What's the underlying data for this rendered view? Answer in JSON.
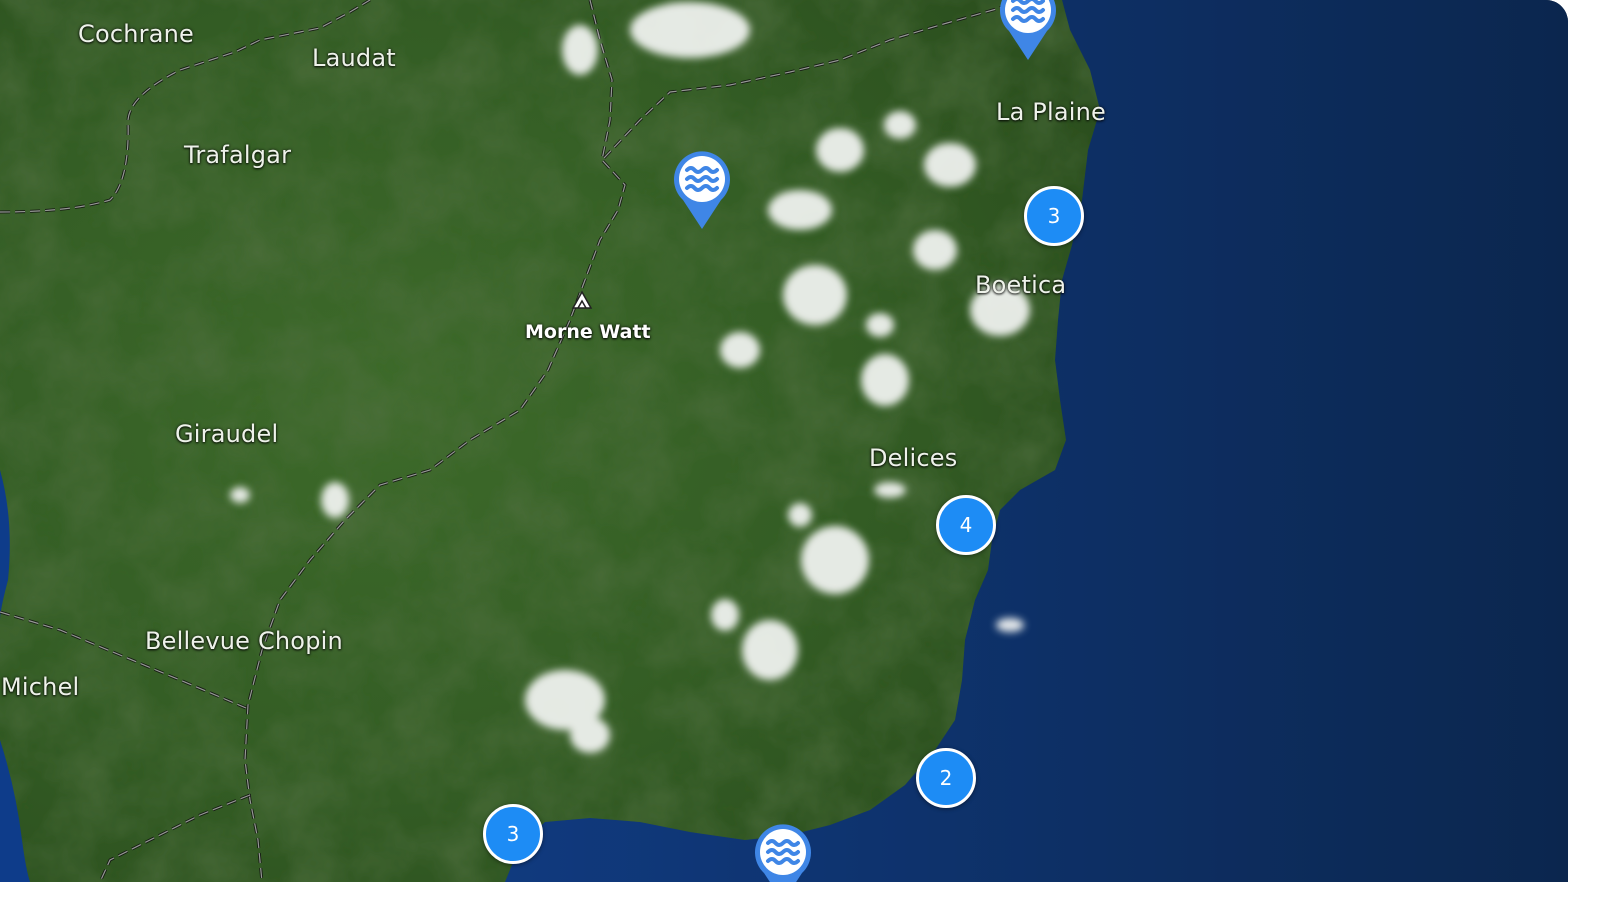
{
  "colors": {
    "ocean": "#0b2a63",
    "ocean_deep": "#071a36",
    "land": "#3e6b2c",
    "marker": "#1d8cf5",
    "pin": "#3f86e6"
  },
  "map": {
    "places": [
      {
        "id": "cochrane",
        "label": "Cochrane"
      },
      {
        "id": "laudat",
        "label": "Laudat"
      },
      {
        "id": "trafalgar",
        "label": "Trafalgar"
      },
      {
        "id": "la-plaine",
        "label": "La Plaine"
      },
      {
        "id": "boetica",
        "label": "Boetica"
      },
      {
        "id": "giraudel",
        "label": "Giraudel"
      },
      {
        "id": "delices",
        "label": "Delices"
      },
      {
        "id": "bellevue-chopin",
        "label": "Bellevue Chopin"
      },
      {
        "id": "michel",
        "label": "Michel"
      }
    ],
    "peak": {
      "label": "Morne Watt",
      "icon": "mountain-peak-icon"
    },
    "clusters": [
      {
        "count": "3"
      },
      {
        "count": "4"
      },
      {
        "count": "2"
      },
      {
        "count": "3"
      }
    ],
    "pins": [
      {
        "icon": "water-waves-icon"
      },
      {
        "icon": "water-waves-icon"
      },
      {
        "icon": "water-waves-icon"
      }
    ]
  }
}
